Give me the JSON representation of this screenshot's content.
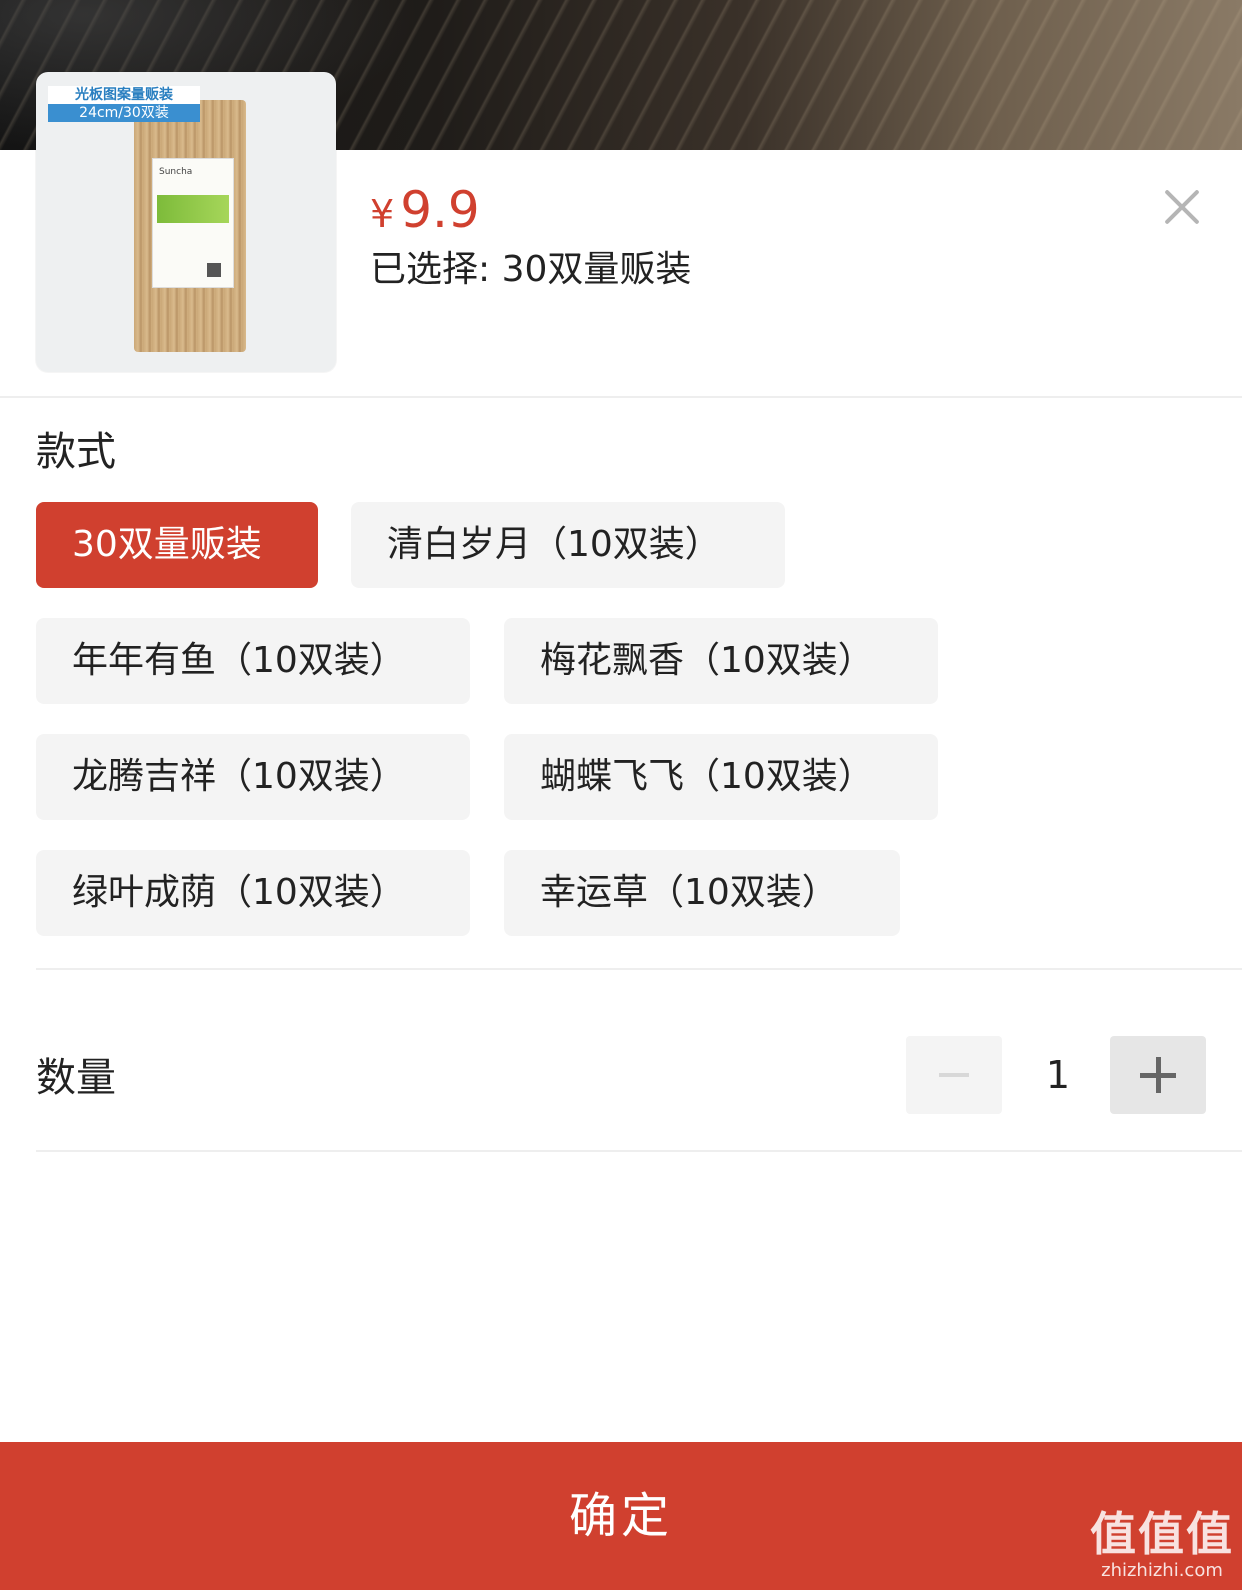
{
  "product": {
    "image_tag_line1": "光板图案量贩装",
    "image_tag_line2": "24cm/30双装",
    "image_brand": "Suncha",
    "price_symbol": "¥",
    "price_value": "9.9",
    "selected_text": "已选择: 30双量贩装"
  },
  "style_section": {
    "title": "款式",
    "options": [
      {
        "label": "30双量贩装",
        "selected": true
      },
      {
        "label": "清白岁月（10双装）",
        "selected": false
      },
      {
        "label": "年年有鱼（10双装）",
        "selected": false
      },
      {
        "label": "梅花飘香（10双装）",
        "selected": false
      },
      {
        "label": "龙腾吉祥（10双装）",
        "selected": false
      },
      {
        "label": "蝴蝶飞飞（10双装）",
        "selected": false
      },
      {
        "label": "绿叶成荫（10双装）",
        "selected": false
      },
      {
        "label": "幸运草（10双装）",
        "selected": false
      }
    ]
  },
  "quantity": {
    "title": "数量",
    "value": "1"
  },
  "confirm_label": "确定",
  "watermark": {
    "title": "值值值",
    "url": "zhizhizhi.com"
  },
  "colors": {
    "accent": "#d0402f",
    "option_bg": "#f4f4f4"
  }
}
